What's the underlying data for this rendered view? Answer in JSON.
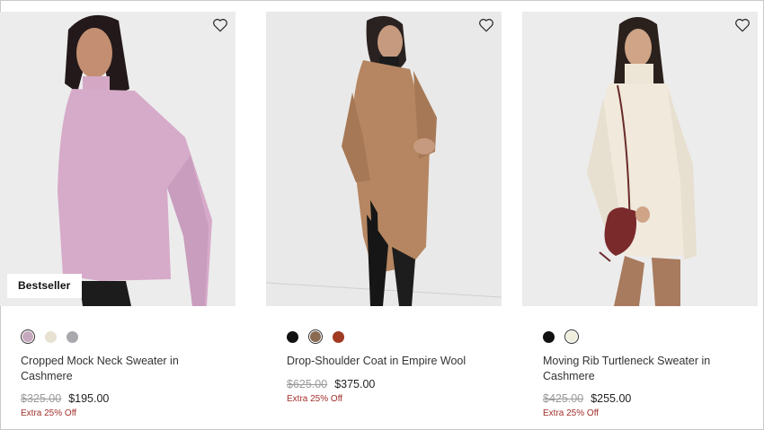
{
  "products": [
    {
      "name": "Drop-Shoulder Coat in Empire Wool",
      "original_price": "$625.00",
      "sale_price": "$375.00",
      "promo": "Extra 25% Off",
      "badge": "",
      "swatches": [
        "#111111",
        "#8a6a52",
        "#a13a22"
      ],
      "selected_swatch": 1,
      "icon": "heart-outline-icon"
    },
    {
      "name": "Moving Rib Turtleneck Sweater in Cashmere",
      "original_price": "$425.00",
      "sale_price": "$255.00",
      "promo": "Extra 25% Off",
      "badge": "",
      "swatches": [
        "#111111",
        "#f0eedc"
      ],
      "selected_swatch": 1,
      "icon": "heart-outline-icon"
    },
    {
      "name": "Cropped Mock Neck Sweater in Cashmere",
      "original_price": "$325.00",
      "sale_price": "$195.00",
      "promo": "Extra 25% Off",
      "badge": "Bestseller",
      "swatches": [
        "#c7a9be",
        "#e6e1d0",
        "#a9a9ad"
      ],
      "selected_swatch": 0,
      "icon": "heart-outline-icon"
    }
  ],
  "colors": {
    "promo_red": "#a1302b",
    "strike_grey": "#9a9a9a",
    "background": "#ffffff"
  }
}
